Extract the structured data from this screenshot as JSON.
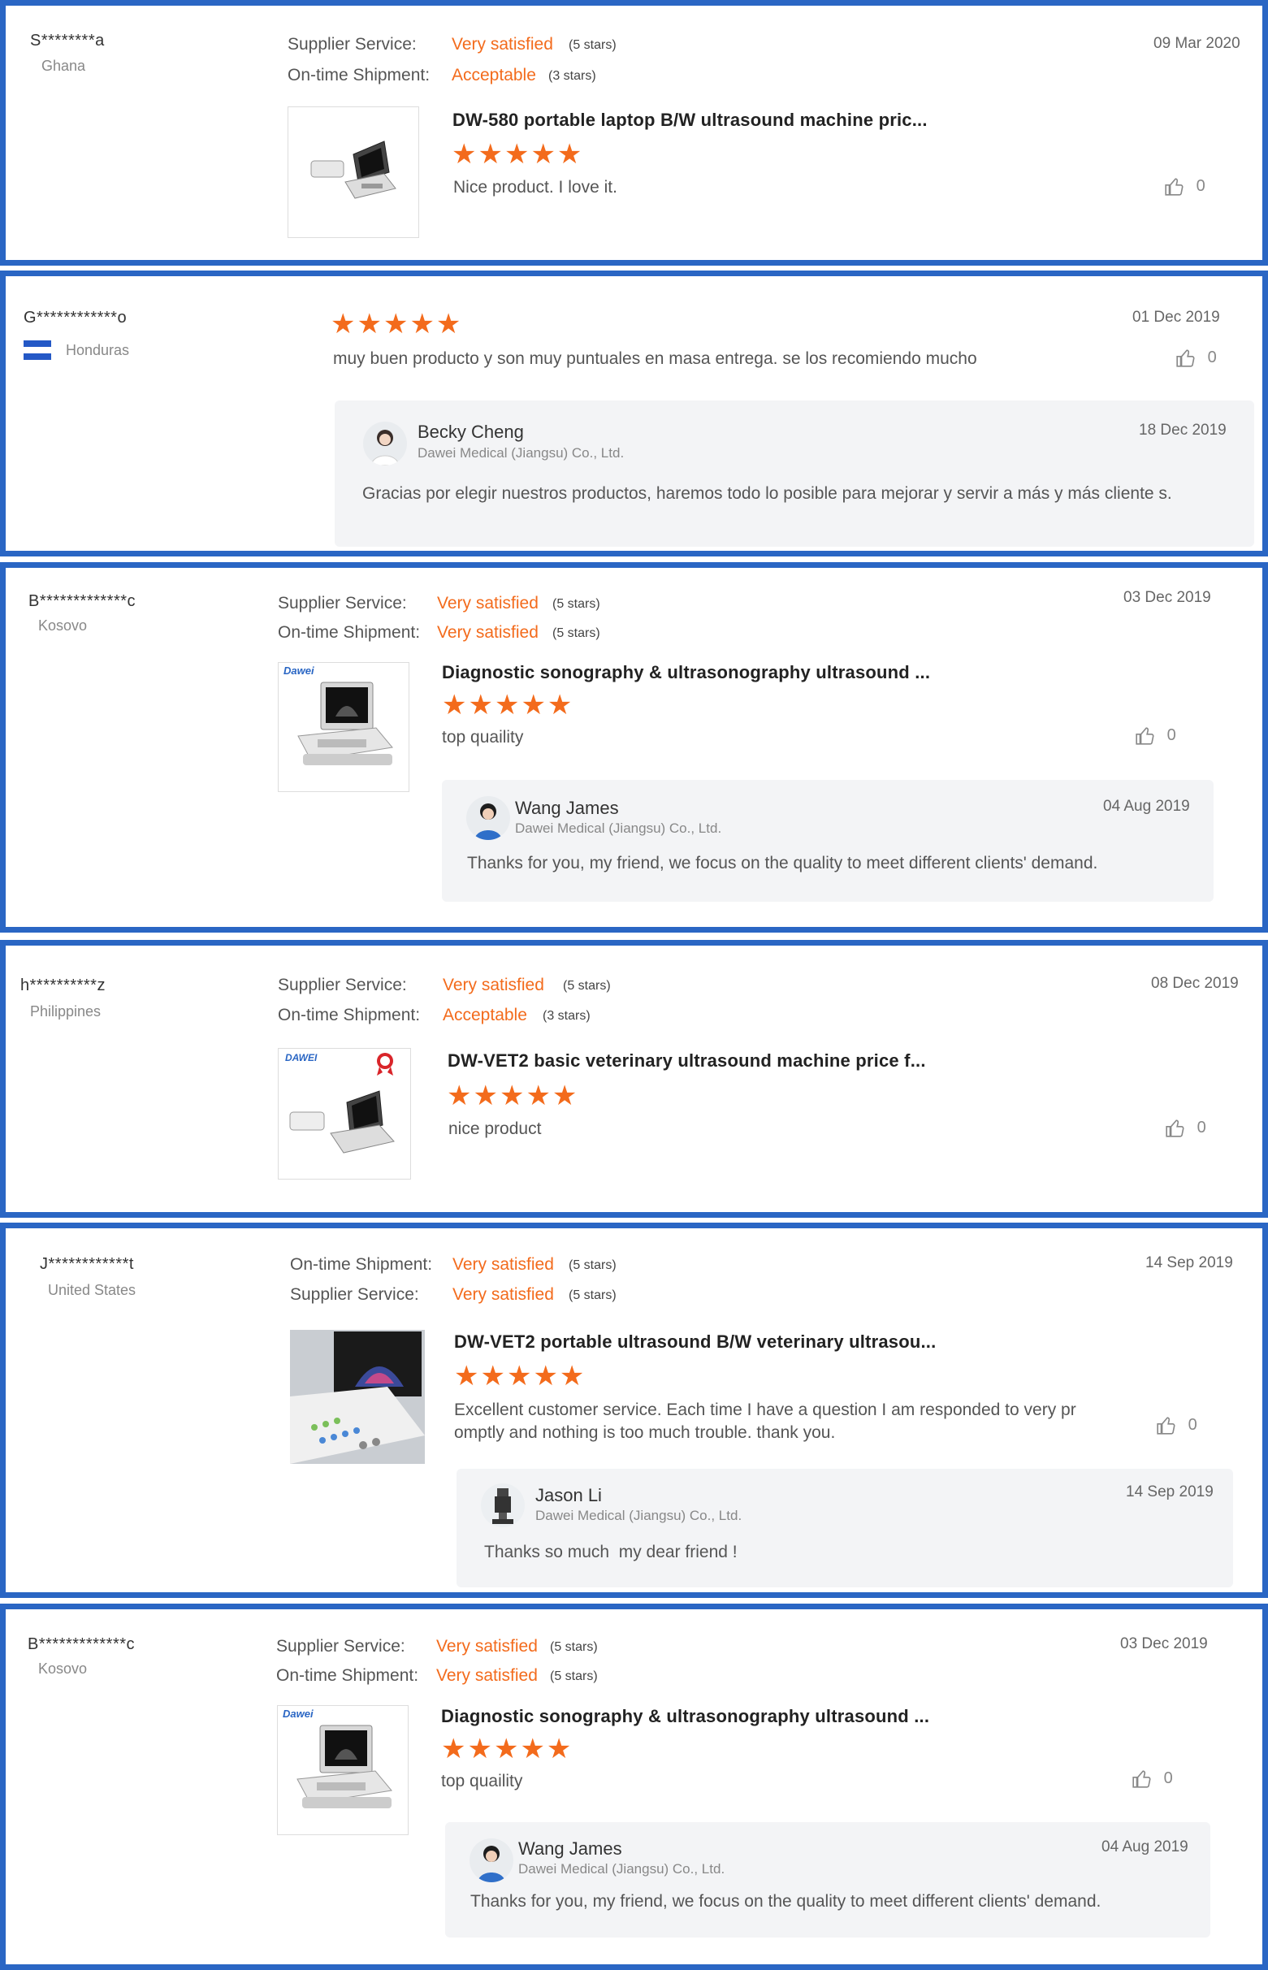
{
  "labels": {
    "supplier_service": "Supplier Service:",
    "on_time_shipment": "On-time Shipment:"
  },
  "colors": {
    "border": "#2a66c4",
    "accent": "#f36b1c"
  },
  "reviews": [
    {
      "buyer": "S********a",
      "country": "Ghana",
      "date": "09 Mar 2020",
      "supplier_value": "Very satisfied",
      "supplier_stars": "(5 stars)",
      "shipment_value": "Acceptable",
      "shipment_stars": "(3 stars)",
      "product": "DW-580 portable laptop B/W ultrasound machine pric...",
      "rating": 5,
      "comment": "Nice product. I love it.",
      "likes": "0"
    },
    {
      "buyer": "G************o",
      "country": "Honduras",
      "date": "01 Dec 2019",
      "rating": 5,
      "comment": "muy buen producto y son muy puntuales en masa entrega. se los recomiendo mucho",
      "likes": "0",
      "reply": {
        "name": "Becky Cheng",
        "company": "Dawei Medical (Jiangsu) Co., Ltd.",
        "date": "18 Dec 2019",
        "text": "Gracias por elegir nuestros productos, haremos todo lo posible para mejorar y servir a más y más cliente s."
      }
    },
    {
      "buyer": "B*************c",
      "country": "Kosovo",
      "date": "03 Dec 2019",
      "supplier_value": "Very satisfied",
      "supplier_stars": "(5 stars)",
      "shipment_value": "Very satisfied",
      "shipment_stars": "(5 stars)",
      "product": "Diagnostic sonography & ultrasonography ultrasound ...",
      "rating": 5,
      "comment": "top quaility",
      "likes": "0",
      "reply": {
        "name": "Wang James",
        "company": "Dawei Medical (Jiangsu) Co., Ltd.",
        "date": "04 Aug 2019",
        "text": "Thanks for you, my friend, we focus on the quality to meet different clients' demand."
      }
    },
    {
      "buyer": "h**********z",
      "country": "Philippines",
      "date": "08 Dec 2019",
      "supplier_value": "Very satisfied",
      "supplier_stars": "(5 stars)",
      "shipment_value": "Acceptable",
      "shipment_stars": "(3 stars)",
      "product": "DW-VET2 basic veterinary ultrasound machine price f...",
      "rating": 5,
      "comment": "nice product",
      "likes": "0"
    },
    {
      "buyer": "J************t",
      "country": "United States",
      "date": "14 Sep 2019",
      "shipment_value": "Very satisfied",
      "shipment_stars": "(5 stars)",
      "supplier_value": "Very satisfied",
      "supplier_stars": "(5 stars)",
      "product": "DW-VET2 portable ultrasound B/W veterinary ultrasou...",
      "rating": 5,
      "comment": "Excellent customer service. Each time I have a question I am responded to very pr omptly and nothing is too much trouble. thank you.",
      "likes": "0",
      "reply": {
        "name": "Jason Li",
        "company": "Dawei Medical (Jiangsu) Co., Ltd.",
        "date": "14 Sep 2019",
        "text": "Thanks so much  my dear friend !"
      }
    },
    {
      "buyer": "B*************c",
      "country": "Kosovo",
      "date": "03 Dec 2019",
      "supplier_value": "Very satisfied",
      "supplier_stars": "(5 stars)",
      "shipment_value": "Very satisfied",
      "shipment_stars": "(5 stars)",
      "product": "Diagnostic sonography & ultrasonography ultrasound ...",
      "rating": 5,
      "comment": "top quaility",
      "likes": "0",
      "reply": {
        "name": "Wang James",
        "company": "Dawei Medical (Jiangsu) Co., Ltd.",
        "date": "04 Aug 2019",
        "text": "Thanks for you, my friend, we focus on the quality to meet different clients' demand."
      }
    }
  ],
  "product_logos": {
    "dawei": "Dawei",
    "dawei_caps": "DAWEI"
  },
  "stars_glyphs": "★★★★★"
}
